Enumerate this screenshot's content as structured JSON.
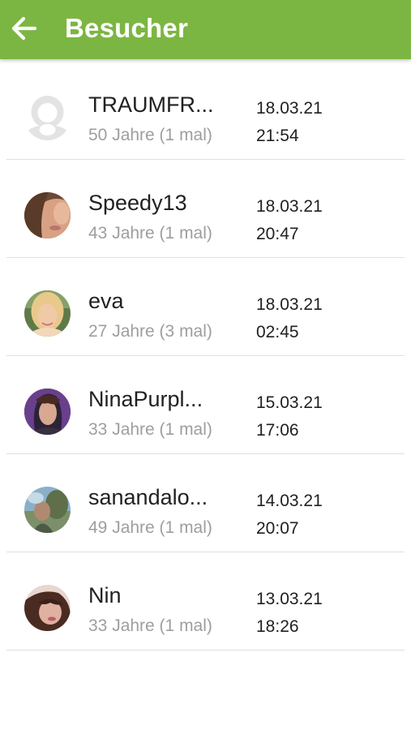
{
  "header": {
    "title": "Besucher",
    "back_icon": "arrow-left-icon",
    "bar_color": "#7cb642"
  },
  "visitors": [
    {
      "name": "TRAUMFR...",
      "info": "50 Jahre (1 mal)",
      "date": "18.03.21",
      "time": "21:54",
      "avatar": "placeholder-avatar"
    },
    {
      "name": "Speedy13",
      "info": "43 Jahre (1 mal)",
      "date": "18.03.21",
      "time": "20:47",
      "avatar": "photo-avatar"
    },
    {
      "name": "eva",
      "info": "27 Jahre (3 mal)",
      "date": "18.03.21",
      "time": "02:45",
      "avatar": "photo-avatar"
    },
    {
      "name": "NinaPurpl...",
      "info": "33 Jahre (1 mal)",
      "date": "15.03.21",
      "time": "17:06",
      "avatar": "photo-avatar"
    },
    {
      "name": "sanandalo...",
      "info": "49 Jahre (1 mal)",
      "date": "14.03.21",
      "time": "20:07",
      "avatar": "photo-avatar"
    },
    {
      "name": "Nin",
      "info": "33 Jahre (1 mal)",
      "date": "13.03.21",
      "time": "18:26",
      "avatar": "photo-avatar"
    }
  ]
}
